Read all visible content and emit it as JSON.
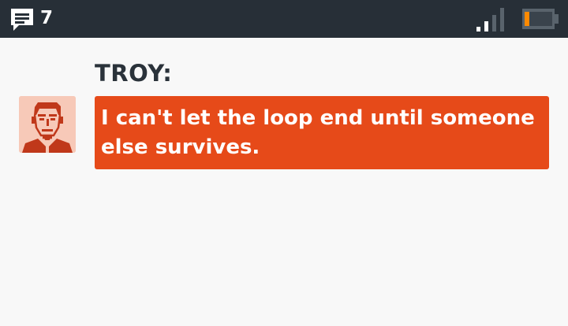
{
  "status_bar": {
    "message_icon": "chat-bubble-icon",
    "message_count": "7",
    "signal_icon": "signal-strength-icon",
    "signal_level": 0.5,
    "battery_icon": "battery-icon",
    "battery_level": 0.15,
    "colors": {
      "background": "#272f37",
      "battery_fill": "#ff8a00"
    }
  },
  "dialogue": {
    "speaker": "TROY:",
    "avatar_icon": "troy-portrait-icon",
    "message": "I can't let the loop end until someone else survives.",
    "colors": {
      "bubble": "#e64a19",
      "text": "#ffffff",
      "avatar_bg": "#f7c9b8"
    }
  }
}
